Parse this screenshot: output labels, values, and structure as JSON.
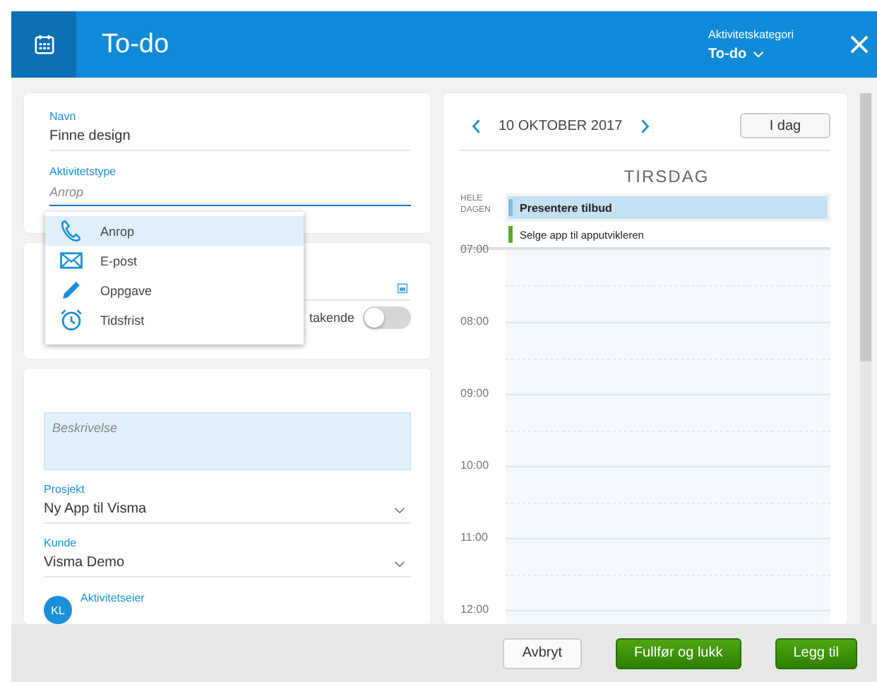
{
  "header": {
    "title": "To-do",
    "category_label": "Aktivitetskategori",
    "category_value": "To-do"
  },
  "form": {
    "name": {
      "label": "Navn",
      "value": "Finne design"
    },
    "type": {
      "label": "Aktivitetstype",
      "placeholder": "Anrop"
    },
    "type_options": [
      {
        "label": "Anrop",
        "kind": "phone",
        "selected": true
      },
      {
        "label": "E-post",
        "kind": "mail",
        "selected": false
      },
      {
        "label": "Oppgave",
        "kind": "pencil",
        "selected": false
      },
      {
        "label": "Tidsfrist",
        "kind": "alarm",
        "selected": false
      }
    ],
    "ongoing": {
      "label": "takende",
      "on": false
    },
    "description": {
      "placeholder": "Beskrivelse"
    },
    "project": {
      "label": "Prosjekt",
      "value": "Ny App til Visma"
    },
    "customer": {
      "label": "Kunde",
      "value": "Visma Demo"
    },
    "owner": {
      "label": "Aktivitetseier",
      "initials": "KL"
    }
  },
  "calendar": {
    "date": "10 OKTOBER 2017",
    "today_button": "I dag",
    "weekday": "TIRSDAG",
    "all_day_label": "HELE DAGEN",
    "events": [
      {
        "title": "Presentere tilbud",
        "color": "#7fbde8",
        "kind": "highlighted"
      },
      {
        "title": "Selge app til apputvikleren",
        "color": "#5fa82b",
        "kind": "plain"
      }
    ],
    "hours": [
      "07:00",
      "08:00",
      "09:00",
      "10:00",
      "11:00",
      "12:00"
    ]
  },
  "buttons": [
    {
      "label": "Avbryt",
      "kind": "secondary"
    },
    {
      "label": "Fullfør og lukk",
      "kind": "primary"
    },
    {
      "label": "Legg til",
      "kind": "primary"
    }
  ]
}
